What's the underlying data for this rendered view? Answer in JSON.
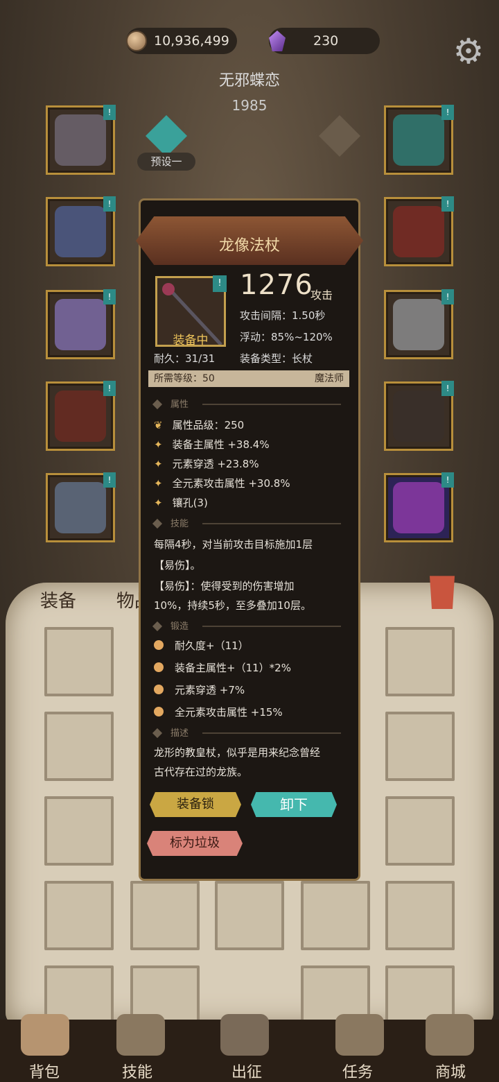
{
  "currency": {
    "gold": "10,936,499",
    "gems": "230"
  },
  "character": {
    "name": "无邪蝶恋",
    "level": "1985",
    "preset": "预设一"
  },
  "tabs": {
    "equipment": "装备",
    "items": "物品"
  },
  "slot_tag": "!",
  "popup": {
    "title": "龙像法杖",
    "equipped_label": "装备中",
    "attack_value": "1276",
    "attack_unit": "攻击",
    "attack_interval": "攻击间隔：1.50秒",
    "float": "浮动：85%~120%",
    "equip_type": "装备类型：长杖",
    "durability": "耐久：31/31",
    "required_level": "所需等级：50",
    "class": "魔法师",
    "sections": {
      "attributes": "属性",
      "skills": "技能",
      "forge": "锻造",
      "description": "描述"
    },
    "attr_grade": "属性品级：250",
    "attributes": [
      "装备主属性 +38.4%",
      "元素穿透 +23.8%",
      "全元素攻击属性 +30.8%",
      "镶孔(3)"
    ],
    "skill_lines": [
      "每隔4秒，对当前攻击目标施加1层",
      "【易伤】。",
      "【易伤】：使得受到的伤害增加",
      "10%，持续5秒，至多叠加10层。"
    ],
    "forge_lines": [
      "耐久度+（11）",
      "装备主属性+（11）*2%",
      "元素穿透 +7%",
      "全元素攻击属性 +15%"
    ],
    "desc_lines": [
      "龙形的教皇杖，似乎是用来纪念曾经",
      "古代存在过的龙族。"
    ],
    "buttons": {
      "lock": "装备锁",
      "unequip": "卸下",
      "junk": "标为垃圾"
    }
  },
  "nav": [
    "背包",
    "技能",
    "出征",
    "任务",
    "商城"
  ]
}
